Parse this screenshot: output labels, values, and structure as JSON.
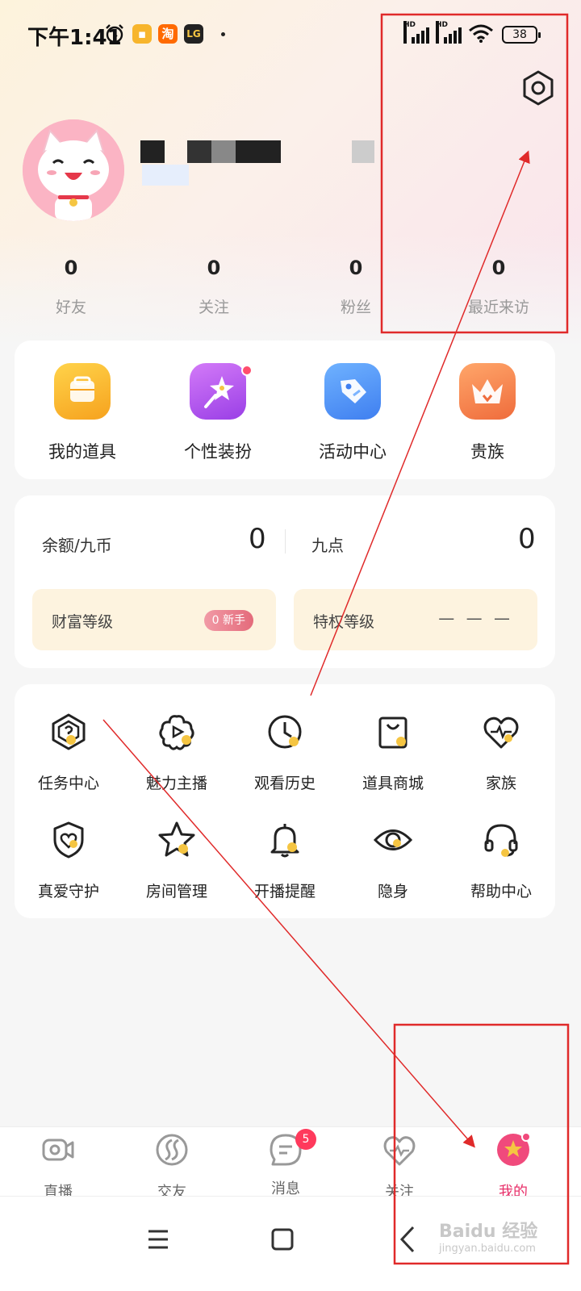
{
  "status_bar": {
    "time": "下午1:41",
    "app_icons": [
      {
        "name": "taobao-icon",
        "text": "淘",
        "color": "#ff6a00"
      },
      {
        "name": "app-lg-icon",
        "text": "LG",
        "color": "#222222"
      }
    ],
    "signal_label": "HD",
    "battery": "38"
  },
  "profile": {
    "stats": [
      {
        "value": "0",
        "label": "好友"
      },
      {
        "value": "0",
        "label": "关注"
      },
      {
        "value": "0",
        "label": "粉丝"
      },
      {
        "value": "0",
        "label": "最近来访"
      }
    ]
  },
  "quick_actions": [
    {
      "label": "我的道具",
      "icon": "toolbox-icon",
      "color": "#f7b52c",
      "has_dot": false
    },
    {
      "label": "个性装扮",
      "icon": "magic-wand-icon",
      "color": "#b45af0",
      "has_dot": true
    },
    {
      "label": "活动中心",
      "icon": "tag-icon",
      "color": "#4a8ef5",
      "has_dot": false
    },
    {
      "label": "贵族",
      "icon": "crown-icon",
      "color": "#f58a4a",
      "has_dot": false
    }
  ],
  "wallet": {
    "balance_label": "余额/九币",
    "balance_value": "0",
    "points_label": "九点",
    "points_value": "0",
    "wealth_label": "财富等级",
    "wealth_badge": "0 新手",
    "privilege_label": "特权等级",
    "privilege_value": "— — —"
  },
  "grid_menu": [
    {
      "label": "任务中心",
      "icon": "task-hexagon-icon"
    },
    {
      "label": "魅力主播",
      "icon": "flower-play-icon"
    },
    {
      "label": "观看历史",
      "icon": "clock-icon"
    },
    {
      "label": "道具商城",
      "icon": "shopping-bag-icon"
    },
    {
      "label": "家族",
      "icon": "heart-pulse-icon"
    },
    {
      "label": "真爱守护",
      "icon": "shield-heart-icon"
    },
    {
      "label": "房间管理",
      "icon": "star-icon"
    },
    {
      "label": "开播提醒",
      "icon": "bell-icon"
    },
    {
      "label": "隐身",
      "icon": "eye-icon"
    },
    {
      "label": "帮助中心",
      "icon": "headset-icon"
    }
  ],
  "bottom_nav": [
    {
      "label": "直播",
      "icon": "camera-icon",
      "active": false
    },
    {
      "label": "交友",
      "icon": "swirl-icon",
      "active": false
    },
    {
      "label": "消息",
      "icon": "chat-icon",
      "active": false,
      "badge": "5"
    },
    {
      "label": "关注",
      "icon": "heart-icon",
      "active": false
    },
    {
      "label": "我的",
      "icon": "profile-star-icon",
      "active": true
    }
  ],
  "watermark": {
    "brand": "Baidu 经验",
    "url": "jingyan.baidu.com"
  },
  "colors": {
    "accent": "#e8306a",
    "icon_yellow": "#f5c542",
    "annotation_red": "#e02a2a"
  }
}
